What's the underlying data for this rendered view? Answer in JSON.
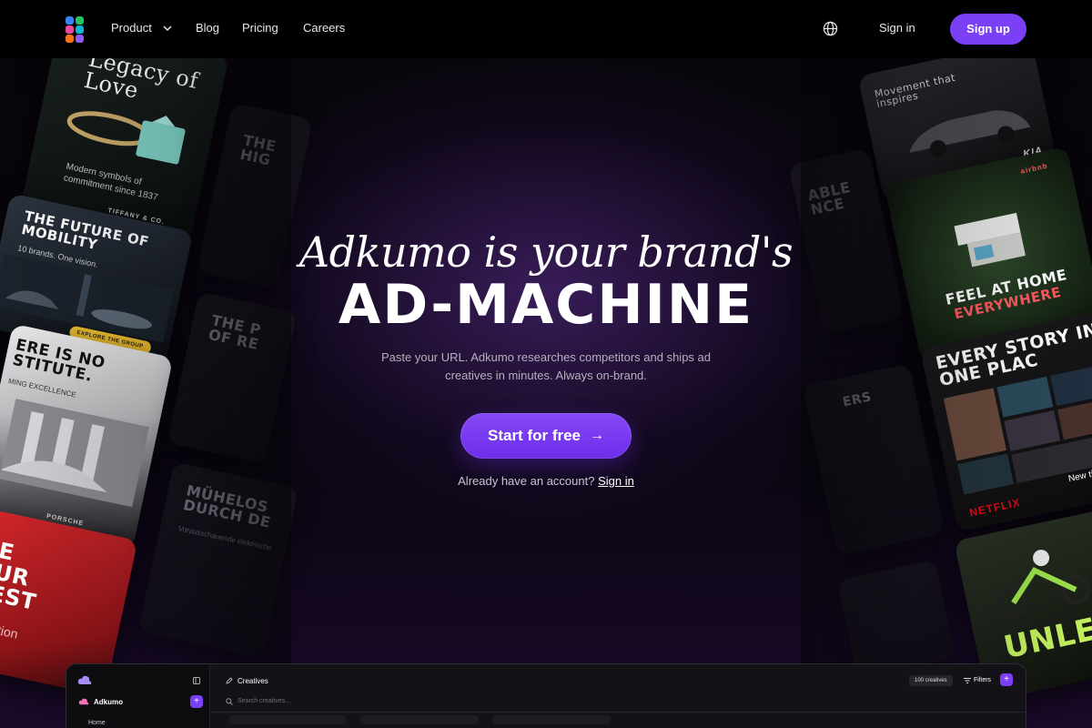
{
  "colors": {
    "accent": "#7b3ff5",
    "background": "#060409",
    "nav": "#000000"
  },
  "nav": {
    "links": [
      "Product",
      "Blog",
      "Pricing",
      "Careers"
    ],
    "sign_in": "Sign in",
    "sign_up": "Sign up"
  },
  "hero": {
    "line1": "Adkumo is your brand's",
    "line2": "AD-MACHINE",
    "subtitle": "Paste your URL. Adkumo researches competitors and ships ad creatives in minutes. Always on-brand.",
    "cta": "Start for free",
    "account_prompt": "Already have an account?",
    "account_link": "Sign in"
  },
  "ads": {
    "tiffany_title": "Legacy of Love",
    "tiffany_sub": "Modern symbols of commitment since 1837",
    "tiffany_brand": "TIFFANY & CO.",
    "mobility_title": "THE FUTURE OF MOBILITY",
    "mobility_sub": "10 brands. One vision.",
    "mobility_cta": "EXPLORE THE GROUP",
    "porsche_title": "ERE IS NO STITUTE.",
    "porsche_sub": "MING EXCELLENCE",
    "porsche_brand": "PORSCHE",
    "red_title": "E UR EST",
    "red_sub": "ection",
    "mid_left_1": "THE HIG",
    "mid_left_2": "THE P OF RE",
    "mid_left_3": "MÜHELOS DURCH DE",
    "mid_left_3_sub": "Vorausschauende elektrische",
    "kia_title": "Movement that inspires",
    "kia_brand": "KIA",
    "airbnb_title": "FEEL AT HOME",
    "airbnb_title2": "EVERYWHERE",
    "airbnb_brand": "airbnb",
    "netflix_title": "EVERY STORY IN ONE PLAC",
    "netflix_brand": "NETFLIX",
    "netflix_sub": "New title",
    "moto_title": "UNLEA",
    "mid_right_1": "ABLE NCE",
    "mid_right_2": "ERS"
  },
  "app": {
    "section": "Creatives",
    "brand": "Adkumo",
    "search_placeholder": "Search creatives...",
    "count_badge": "100 creatives",
    "filters": "Filters",
    "home": "Home"
  }
}
